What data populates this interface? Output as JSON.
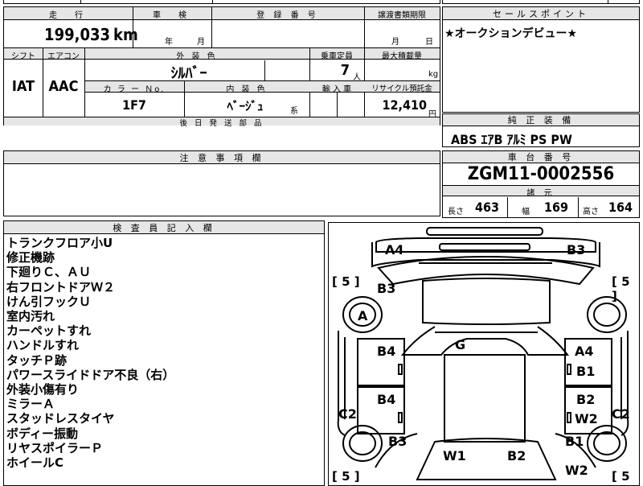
{
  "top_left": {
    "h_mileage": "走　行",
    "h_inspection": "車　検",
    "h_registration": "登 録 番 号",
    "h_transfer": "譲渡書類期限",
    "mileage": "199,033",
    "mileage_unit": "km",
    "insp_year": "年",
    "insp_month": "月",
    "transfer_month": "月",
    "transfer_day": "日",
    "h_shift": "シフト",
    "h_ac": "エアコン",
    "h_ext_color": "外 装 色",
    "h_capacity": "乗車定員",
    "h_max_load": "最大積載量",
    "shift": "IAT",
    "ac": "AAC",
    "ext_color": "ｼﾙﾊﾞｰ",
    "capacity": "7",
    "capacity_unit": "人",
    "load_unit": "kg",
    "h_color_no": "カ ラ ー Ｎo.",
    "h_int_color": "内 装 色",
    "h_import": "輸 入 車",
    "h_recycle": "リサイクル預託金",
    "color_no": "1F7",
    "int_color": "ﾍﾞｰｼﾞｭ",
    "int_suffix": "系",
    "recycle": "12,410",
    "recycle_unit": "円",
    "h_later_parts": "後 日 発 送 部 品"
  },
  "sales_point": {
    "header": "セールスポイント",
    "text": "★オークションデビュー★"
  },
  "equipment": {
    "header": "純 正 装 備",
    "text": "ABS ｴｱB ｱﾙﾐ PS PW"
  },
  "notes": {
    "header": "注 意 事 項 欄"
  },
  "chassis": {
    "header": "車 台 番 号",
    "number": "ZGM11-0002556",
    "specs_header": "諸 元",
    "len_label": "長さ",
    "length": "463",
    "wid_label": "幅",
    "width": "169",
    "hgt_label": "高さ",
    "height": "164"
  },
  "inspector": {
    "header": "検 査 員 記 入 欄",
    "lines": [
      "トランクフロア小U",
      "修正機跡",
      "下廻りＣ、ＡＵ",
      "右フロントドアＷ２",
      "けん引フックＵ",
      "室内汚れ",
      "カーペットすれ",
      "ハンドルすれ",
      "タッチＰ跡",
      "パワースライドドア不良（右）",
      "外装小傷有り",
      "ミラーＡ",
      "スタッドレスタイヤ",
      "ボディー振動",
      "リヤスポイラーＰ",
      "ホイールC"
    ]
  },
  "diagram": {
    "labels": {
      "a4_top_left": "A4",
      "b3_top_right": "B3",
      "b3_left": "B3",
      "a_wheel": "A",
      "g_center": "G",
      "b4_left_upper": "B4",
      "a4_right": "A4",
      "b1_right_upper": "B1",
      "b4_left_lower": "B4",
      "b2_right": "B2",
      "c2_left": "C2",
      "w2_right_upper": "W2",
      "c2_right": "C2",
      "b3_left_lower": "B3",
      "b1_right_lower": "B1",
      "w1_bottom": "W1",
      "b2_bottom": "B2",
      "w2_right_lower": "W2"
    },
    "tread": {
      "front_left": "5",
      "front_right": "5",
      "rear_left": "5",
      "rear_right": "5"
    }
  }
}
